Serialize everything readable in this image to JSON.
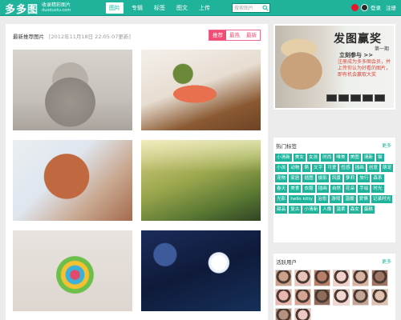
{
  "header": {
    "logo": "多多图",
    "slogan": "收录精彩图片",
    "domain": "duoduotu.com",
    "nav": [
      {
        "label": "图片",
        "active": true
      },
      {
        "label": "专辑",
        "active": false
      },
      {
        "label": "标签",
        "active": false
      },
      {
        "label": "图文",
        "active": false
      },
      {
        "label": "上传",
        "active": false
      }
    ],
    "search_placeholder": "搜索图片",
    "login": "登录",
    "register": "注册"
  },
  "main": {
    "section_title": "最新推荐图片",
    "update_time": "[2012年11月18日 22:05:07更新]",
    "tabs": [
      {
        "label": "推荐",
        "active": true
      },
      {
        "label": "最热",
        "active": false
      },
      {
        "label": "最新",
        "active": false
      }
    ]
  },
  "sidebar": {
    "ad": {
      "title": "发图赢奖",
      "issue": "第一期",
      "cta": "立刻参与 >>",
      "desc": "注册成为多多图会员，并上传你认为好看的图片，即有机会赢取大奖"
    },
    "hot_tags": {
      "title": "热门标签",
      "more": "更多",
      "tags": [
        "小清新",
        "美女",
        "女孩",
        "时尚",
        "唯美",
        "美图",
        "清新",
        "猫",
        "小孩",
        "动物",
        "萌",
        "文字",
        "可爱",
        "性感",
        "插画",
        "创意",
        "萌宠",
        "宠物",
        "家居",
        "插图",
        "摄影",
        "风景",
        "萝莉",
        "旅行",
        "森系",
        "春天",
        "美食",
        "衣服",
        "插画",
        "自然",
        "花朵",
        "手绘",
        "时光",
        "光影",
        "hello kitty",
        "治愈",
        "游戏",
        "温暖",
        "爱情",
        "记录时光",
        "甜品",
        "复古",
        "小清新",
        "人像",
        "温柔",
        "森女",
        "蛋糕"
      ]
    },
    "active_users": {
      "title": "活跃用户",
      "more": "更多"
    }
  },
  "colors": {
    "brand": "#1fb39c",
    "tab_accent": "#f04c74"
  }
}
